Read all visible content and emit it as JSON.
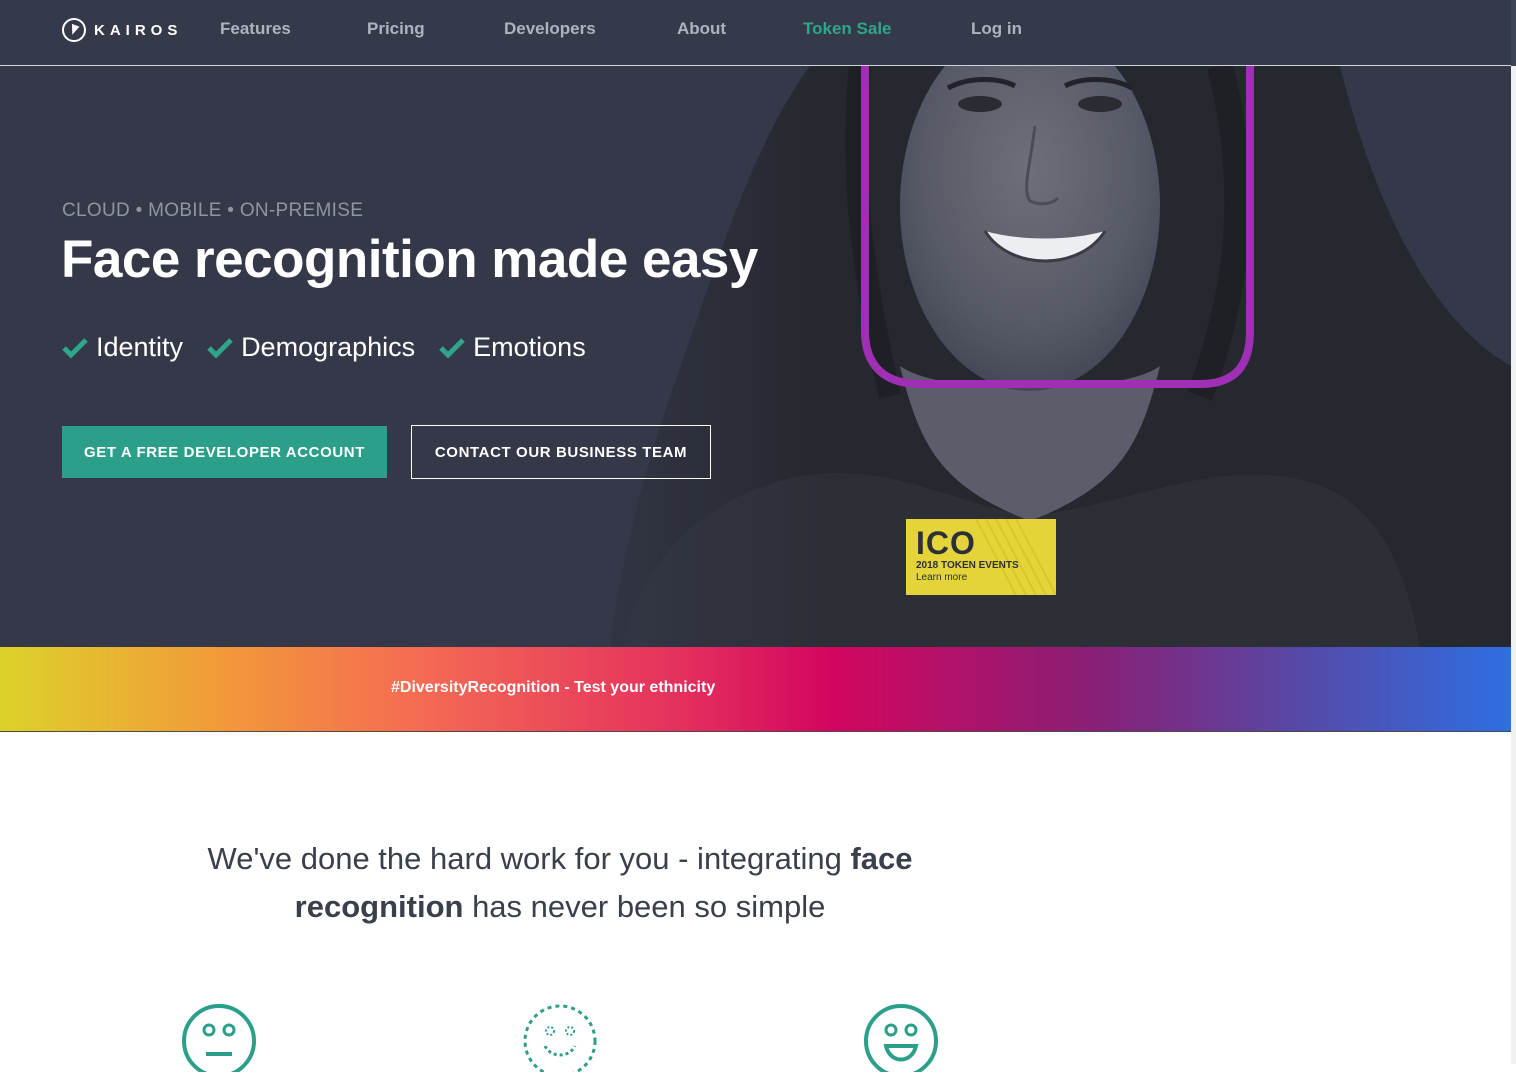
{
  "nav": {
    "logo_text": "KAIROS",
    "links": [
      "Features",
      "Pricing",
      "Developers",
      "About",
      "Token Sale",
      "Log in"
    ]
  },
  "hero": {
    "subtitle": "CLOUD • MOBILE • ON-PREMISE",
    "headline": "Face recognition made easy",
    "features": [
      "Identity",
      "Demographics",
      "Emotions"
    ],
    "primary_button": "GET A FREE DEVELOPER ACCOUNT",
    "secondary_button": "CONTACT OUR BUSINESS TEAM",
    "ico_badge": {
      "title": "ICO",
      "subtitle": "2018 TOKEN EVENTS",
      "link": "Learn more"
    }
  },
  "banner": {
    "text": "#DiversityRecognition - Test your ethnicity"
  },
  "intro": {
    "part1": "We've done the hard work for you - integrating ",
    "bold": "face recognition",
    "part2": " has never been so simple"
  },
  "icons": [
    "neutral-face-icon",
    "dashed-smile-face-icon",
    "happy-face-icon"
  ],
  "colors": {
    "nav_bg": "#343a4a",
    "hero_bg": "#343848",
    "accent": "#2ea58c",
    "face_box": "#a12fb5",
    "ico_yellow": "#e4d43a"
  }
}
